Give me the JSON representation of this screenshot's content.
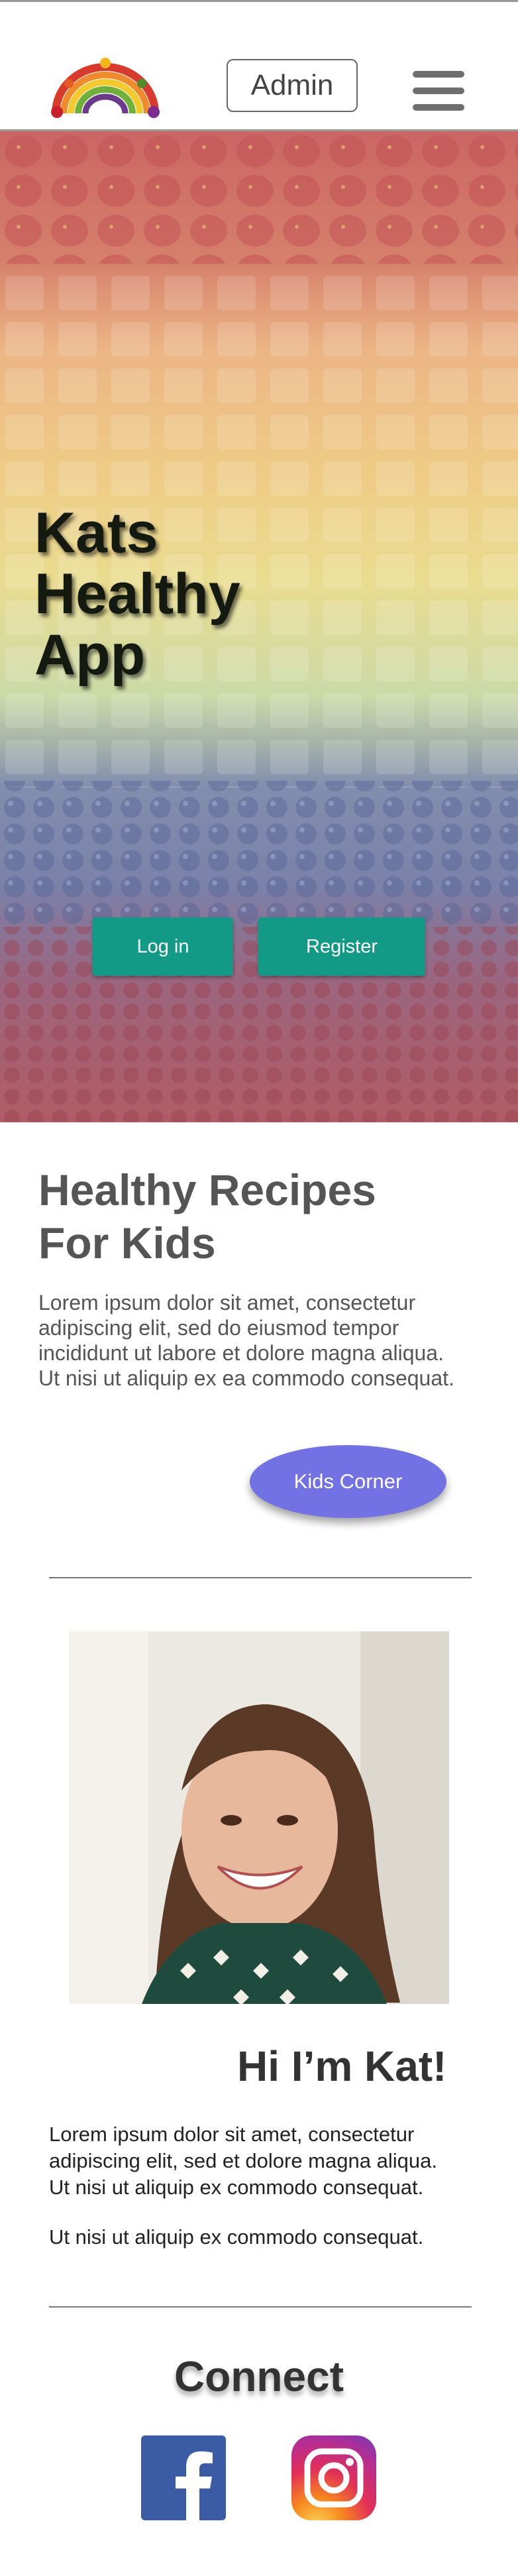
{
  "header": {
    "logo": "fruit-rainbow-logo",
    "admin_label": "Admin",
    "menu_icon": "hamburger-menu-icon"
  },
  "hero": {
    "title": "Kats Healthy App",
    "login_label": "Log in",
    "register_label": "Register",
    "background": "rainbow-fruit-photo"
  },
  "recipes": {
    "title": "Healthy Recipes For Kids",
    "text": "Lorem ipsum dolor sit amet, consectetur\n adipiscing elit, sed do eiusmod tempor\nincididunt ut labore et dolore magna aliqua.\n Ut nisi ut aliquip ex ea commodo consequat.",
    "kids_corner_label": "Kids Corner"
  },
  "about": {
    "photo": "smiling-woman-portrait",
    "title": "Hi I’m Kat!",
    "text": "Lorem ipsum dolor sit amet, consectetur\n adipiscing elit, sed et dolore magna aliqua.\n Ut nisi ut aliquip ex commodo consequat.",
    "text2": "Ut nisi ut aliquip ex commodo consequat."
  },
  "connect": {
    "title": "Connect",
    "facebook_icon": "facebook-icon",
    "instagram_icon": "instagram-icon"
  },
  "colors": {
    "teal_button": "#129a86",
    "kids_button": "#7272e4",
    "facebook_blue": "#3b5ba5"
  }
}
